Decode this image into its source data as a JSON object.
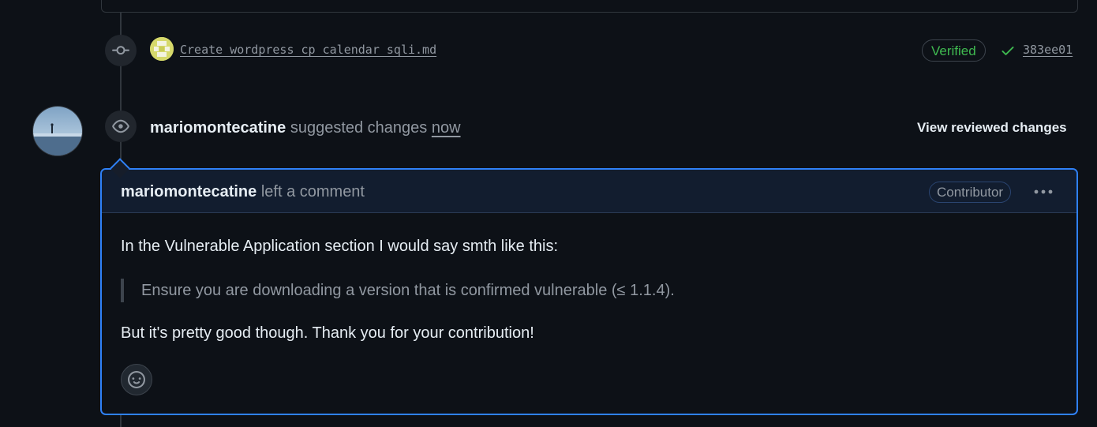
{
  "commit": {
    "message": "Create wordpress_cp_calendar_sqli.md",
    "verified_label": "Verified",
    "sha": "383ee01"
  },
  "review": {
    "author": "mariomontecatine",
    "action": "suggested changes",
    "time": "now",
    "view_changes_label": "View reviewed changes"
  },
  "comment": {
    "author": "mariomontecatine",
    "action": "left a comment",
    "badge": "Contributor",
    "paragraph1": "In the Vulnerable Application section I would say smth like this:",
    "quote": "Ensure you are downloading a version that is confirmed vulnerable (≤ 1.1.4).",
    "paragraph2": "But it's pretty good though. Thank you for your contribution!"
  },
  "icons": {
    "commit": "git-commit-icon",
    "eye": "eye-icon",
    "check": "check-icon",
    "more": "kebab-horizontal-icon",
    "emoji": "smiley-icon"
  },
  "colors": {
    "background": "#0d1117",
    "accent_border": "#2f81f7",
    "verified_green": "#3fb950",
    "muted_text": "#9198a1"
  }
}
